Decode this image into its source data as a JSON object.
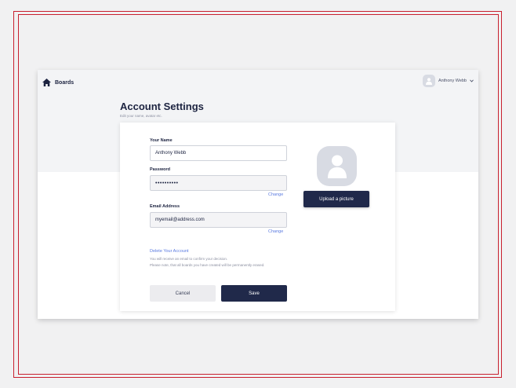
{
  "nav": {
    "brand_label": "Boards",
    "user_name": "Anthony Webb"
  },
  "page": {
    "title": "Account Settings",
    "subtitle": "Edit your name, avatar etc."
  },
  "form": {
    "name_label": "Your Name",
    "name_value": "Anthony Webb",
    "password_label": "Password",
    "password_value": "••••••••••",
    "password_change": "Change",
    "email_label": "Email Address",
    "email_value": "myemail@address.com",
    "email_change": "Change",
    "delete_link": "Delete Your Account",
    "delete_note_1": "You will receive an email to confirm your decision.",
    "delete_note_2": "Please note, that all boards you have created will be permanently erased.",
    "cancel_label": "Cancel",
    "save_label": "Save"
  },
  "avatar": {
    "upload_label": "Upload a picture"
  },
  "colors": {
    "primary": "#20294a",
    "link": "#5b7be0",
    "frame": "#c8202f"
  }
}
